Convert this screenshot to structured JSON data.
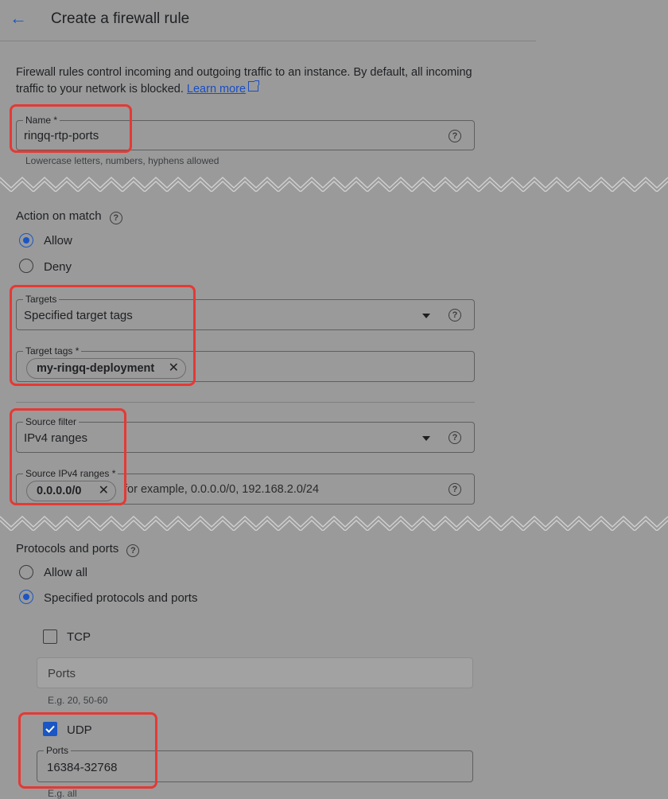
{
  "header": {
    "back_icon": "arrow-left-icon",
    "title": "Create a firewall rule"
  },
  "intro": {
    "text": "Firewall rules control incoming and outgoing traffic to an instance. By default, all incoming traffic to your network is blocked.",
    "link": "Learn more"
  },
  "name_field": {
    "label": "Name *",
    "value": "ringq-rtp-ports",
    "hint": "Lowercase letters, numbers, hyphens allowed"
  },
  "action": {
    "title": "Action on match",
    "options": [
      "Allow",
      "Deny"
    ],
    "selected": "Allow"
  },
  "targets": {
    "label": "Targets",
    "value": "Specified target tags"
  },
  "target_tags": {
    "label": "Target tags *",
    "chip": "my-ringq-deployment"
  },
  "source_filter": {
    "label": "Source filter",
    "value": "IPv4 ranges"
  },
  "source_ranges": {
    "label": "Source IPv4 ranges *",
    "chip": "0.0.0.0/0",
    "placeholder": "for example, 0.0.0.0/0, 192.168.2.0/24"
  },
  "protocols": {
    "title": "Protocols and ports",
    "options": [
      "Allow all",
      "Specified protocols and ports"
    ],
    "selected": "Specified protocols and ports",
    "tcp": {
      "label": "TCP",
      "checked": false,
      "ports_placeholder": "Ports",
      "hint": "E.g. 20, 50-60"
    },
    "udp": {
      "label": "UDP",
      "checked": true,
      "ports_label": "Ports",
      "ports_value": "16384-32768",
      "hint": "E.g. all"
    }
  },
  "colors": {
    "accent": "#1a56c4",
    "highlight": "#e53935",
    "background": "#9a9a9a"
  }
}
